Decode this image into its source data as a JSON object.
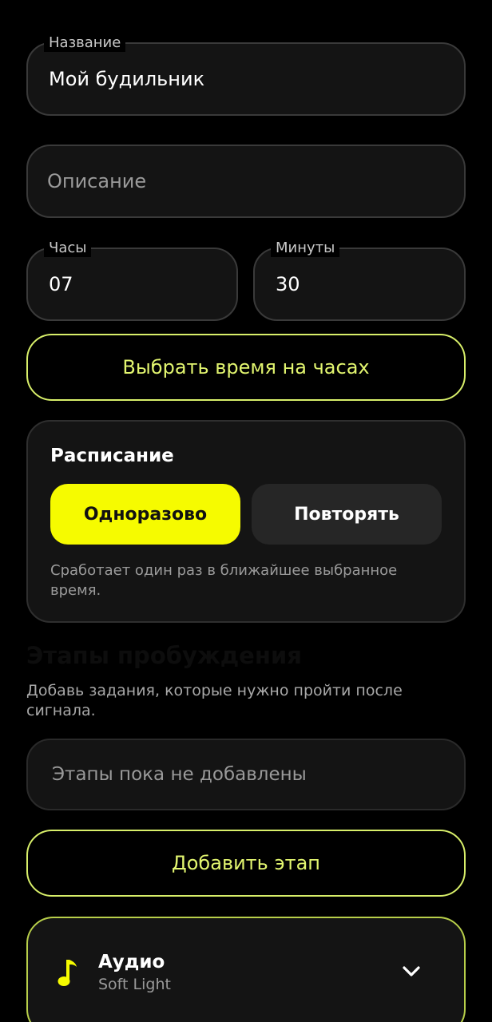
{
  "form": {
    "name": {
      "label": "Название",
      "value": "Мой будильник"
    },
    "description": {
      "placeholder": "Описание"
    },
    "hours": {
      "label": "Часы",
      "value": "07"
    },
    "minutes": {
      "label": "Минуты",
      "value": "30"
    },
    "pick_time_label": "Выбрать время на часах"
  },
  "schedule": {
    "title": "Расписание",
    "options": [
      "Одноразово",
      "Повторять"
    ],
    "selected": "Одноразово",
    "hint": "Сработает один раз в ближайшее выбранное время."
  },
  "stages": {
    "heading": "Этапы пробуждения",
    "subtitle": "Добавь задания, которые нужно пройти после сигнала.",
    "empty_text": "Этапы пока не добавлены",
    "add_label": "Добавить этап"
  },
  "audio": {
    "title": "Аудио",
    "track": "Soft Light",
    "icon": "music-note-icon",
    "expand_icon": "chevron-down-icon"
  },
  "colors": {
    "background": "#000000",
    "accent": "#f6fb00",
    "accent_text": "#e2f56f",
    "surface": "#141414"
  }
}
